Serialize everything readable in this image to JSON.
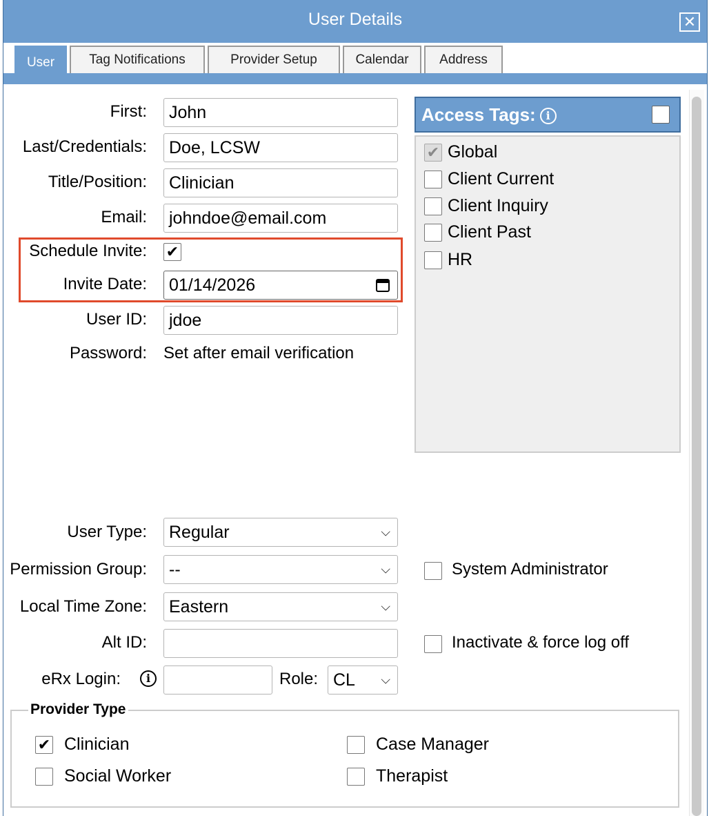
{
  "dialog": {
    "title": "User Details",
    "close_label": "✕"
  },
  "tabs": [
    {
      "label": "User",
      "active": true
    },
    {
      "label": "Tag Notifications",
      "active": false
    },
    {
      "label": "Provider Setup",
      "active": false
    },
    {
      "label": "Calendar",
      "active": false
    },
    {
      "label": "Address",
      "active": false
    }
  ],
  "form": {
    "first_label": "First:",
    "first_value": "John",
    "last_label": "Last/Credentials:",
    "last_value": "Doe, LCSW",
    "title_label": "Title/Position:",
    "title_value": "Clinician",
    "email_label": "Email:",
    "email_value": "johndoe@email.com",
    "schedule_invite_label": "Schedule Invite:",
    "schedule_invite_checked": true,
    "invite_date_label": "Invite Date:",
    "invite_date_value": "01/14/2026",
    "user_id_label": "User ID:",
    "user_id_value": "jdoe",
    "password_label": "Password:",
    "password_value": "Set after email verification",
    "user_type_label": "User Type:",
    "user_type_value": "Regular",
    "permission_group_label": "Permission Group:",
    "permission_group_value": "--",
    "time_zone_label": "Local Time Zone:",
    "time_zone_value": "Eastern",
    "alt_id_label": "Alt ID:",
    "alt_id_value": "",
    "erx_login_label": "eRx Login:",
    "erx_login_value": "",
    "role_label": "Role:",
    "role_value": "CL",
    "sys_admin_label": "System Administrator",
    "inactivate_label": "Inactivate & force log off"
  },
  "access_tags": {
    "header": "Access Tags:",
    "items": [
      {
        "label": "Global",
        "checked": true,
        "disabled": true
      },
      {
        "label": "Client Current",
        "checked": false
      },
      {
        "label": "Client Inquiry",
        "checked": false
      },
      {
        "label": "Client Past",
        "checked": false
      },
      {
        "label": "HR",
        "checked": false
      }
    ]
  },
  "provider_type": {
    "legend": "Provider Type",
    "items": [
      {
        "label": "Clinician",
        "checked": true
      },
      {
        "label": "Case Manager",
        "checked": false
      },
      {
        "label": "Social Worker",
        "checked": false
      },
      {
        "label": "Therapist",
        "checked": false
      }
    ]
  },
  "colors": {
    "header_blue": "#6d9dcf",
    "highlight_red": "#e04a2c"
  }
}
